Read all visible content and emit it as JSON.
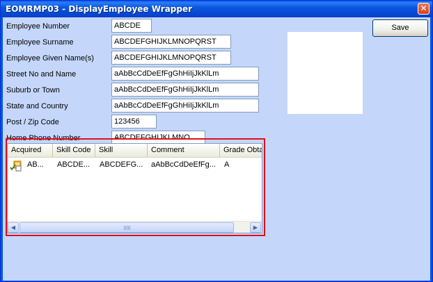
{
  "window": {
    "title": "EOMRMP03 - DisplayEmployee Wrapper",
    "close_glyph": "✕"
  },
  "form": {
    "fields": [
      {
        "label": "Employee Number",
        "value": "ABCDE"
      },
      {
        "label": "Employee Surname",
        "value": "ABCDEFGHIJKLMNOPQRST"
      },
      {
        "label": "Employee Given Name(s)",
        "value": "ABCDEFGHIJKLMNOPQRST"
      },
      {
        "label": "Street No and Name",
        "value": "aAbBcCdDeEfFgGhHiIjJkKlLm"
      },
      {
        "label": "Suburb or Town",
        "value": "aAbBcCdDeEfFgGhHiIjJkKlLm"
      },
      {
        "label": "State and Country",
        "value": "aAbBcCdDeEfFgGhHiIjJkKlLm"
      },
      {
        "label": "Post / Zip Code",
        "value": "123456"
      },
      {
        "label": "Home Phone Number",
        "value": "ABCDEFGHIJKLMNO"
      }
    ]
  },
  "buttons": {
    "save_label": "Save"
  },
  "grid": {
    "columns": [
      "Acquired",
      "Skill Code",
      "Skill",
      "Comment",
      "Grade Obta"
    ],
    "rows": [
      {
        "acquired": "AB...",
        "skill_code": "ABCDE...",
        "skill": "ABCDEFG...",
        "comment": "aAbBcCdDeEfFg...",
        "grade": "A"
      }
    ]
  },
  "icons": {
    "row_icon": "checked-item-icon",
    "scroll_left": "◀",
    "scroll_right": "▶"
  },
  "colors": {
    "client_bg": "#c5d6fb",
    "titlebar": "#0b57e0",
    "highlight_border": "#e0101a"
  }
}
